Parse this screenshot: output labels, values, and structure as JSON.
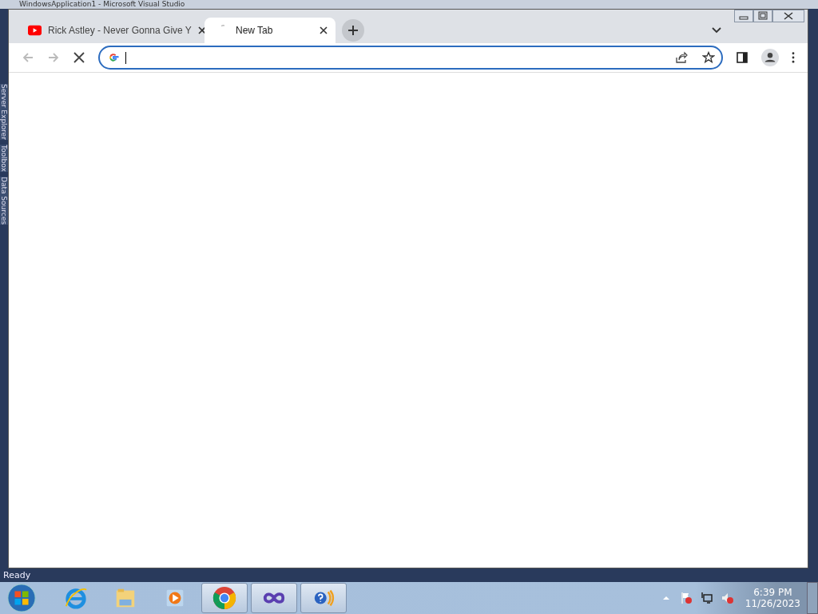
{
  "background_window": {
    "title": "WindowsApplication1 - Microsoft Visual Studio",
    "side_tabs": [
      "Server Explorer",
      "Toolbox",
      "Data Sources"
    ],
    "status": "Ready"
  },
  "browser": {
    "tabs": [
      {
        "title": "Rick Astley - Never Gonna Give Y",
        "selected": false,
        "kind": "video"
      },
      {
        "title": "New Tab",
        "selected": true,
        "kind": "loading"
      }
    ],
    "loading": true
  },
  "taskbar": {
    "apps": [
      {
        "kind": "browser-e",
        "running": false
      },
      {
        "kind": "folder",
        "running": false
      },
      {
        "kind": "player",
        "running": false
      },
      {
        "kind": "chrome",
        "running": true
      },
      {
        "kind": "infinity",
        "running": true
      },
      {
        "kind": "help",
        "running": true
      }
    ],
    "clock": {
      "time": "6:39 PM",
      "date": "11/26/2023"
    }
  }
}
